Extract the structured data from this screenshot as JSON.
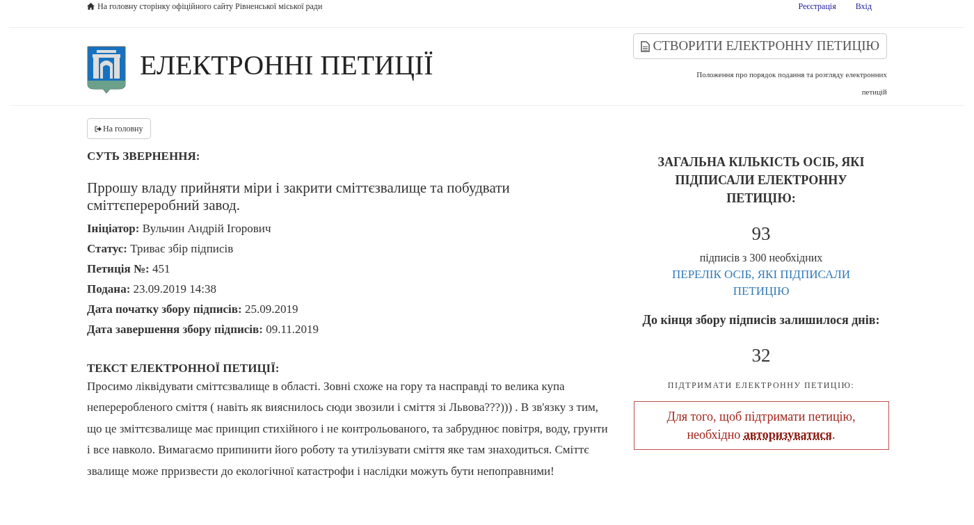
{
  "top_bar": {
    "home_link": "На головну сторінку офіційного сайту Рівненської міської ради",
    "links": [
      "Реєстрація",
      "Вхід"
    ]
  },
  "header": {
    "title": "ЕЛЕКТРОННІ ПЕТИЦІЇ",
    "create_button": "СТВОРИТИ ЕЛЕКТРОННУ ПЕТИЦІЮ",
    "regulation_link": "Положення про порядок подання та розгляду електронних петицій"
  },
  "back_button": "На головну",
  "petition": {
    "subject_heading": "СУТЬ ЗВЕРНЕННЯ:",
    "subject": "Пррошу владу прийняти міри і закрити сміттєзвалище та побудвати сміттєпереробний завод.",
    "fields": [
      {
        "label": "Ініціатор:",
        "value": "Вульчин Андрій Ігорович"
      },
      {
        "label": "Статус:",
        "value": "Триває збір підписів"
      },
      {
        "label": "Петиція №:",
        "value": "451"
      },
      {
        "label": "Подана:",
        "value": "23.09.2019 14:38"
      },
      {
        "label": "Дата початку збору підписів:",
        "value": "25.09.2019"
      },
      {
        "label": "Дата завершення збору підписів:",
        "value": "09.11.2019"
      }
    ],
    "text_heading": "ТЕКСТ ЕЛЕКТРОННОЇ ПЕТИЦІЇ:",
    "text": "Просимо ліквідувати сміттєзвалище в області. Зовні схоже на гору та насправді то велика купа непереробленого сміття ( навіть як вияснилось сюди звозили і сміття зі Львова???))) . В зв'язку з тим, що це зміттєзвалище має принцип стихійного і не контрольованого, та забруднює повітря, воду, грунти і все навколо. Вимагаємо припинити його роботу та утилізувати сміття яке там знаходиться. Сміттє звалище може прризвести до екологічної катастрофи і наслідки можуть бути непоправними!"
  },
  "sidebar": {
    "signatures_heading": "ЗАГАЛЬНА КІЛЬКІСТЬ ОСІБ, ЯКІ ПІДПИСАЛИ ЕЛЕКТРОННУ ПЕТИЦІЮ:",
    "signatures_count": "93",
    "signatures_note": "підписів з 300 необхідних",
    "signers_link": "ПЕРЕЛІК ОСІБ, ЯКІ ПІДПИСАЛИ ПЕТИЦІЮ",
    "days_heading": "До кінця збору підписів залишилося днів:",
    "days_count": "32",
    "support_heading": "ПІДТРИМАТИ ЕЛЕКТРОННУ ПЕТИЦІЮ:",
    "alert": {
      "prefix": "Для того, щоб підтримати петицію, необхідно",
      "link": "авторизуватися",
      "suffix": "."
    }
  }
}
